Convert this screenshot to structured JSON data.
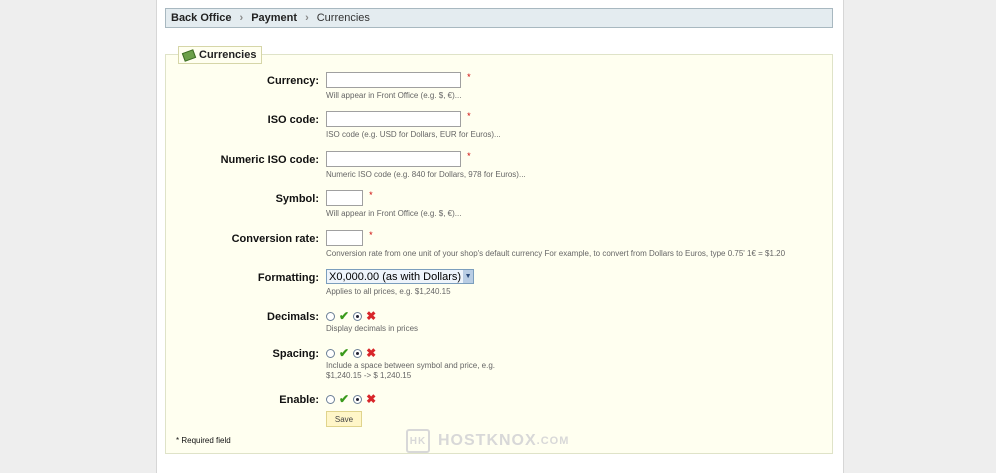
{
  "breadcrumb": {
    "items": [
      "Back Office",
      "Payment",
      "Currencies"
    ],
    "separator": "›"
  },
  "panel": {
    "legend": "Currencies",
    "legend_icon": "money-icon"
  },
  "form": {
    "currency": {
      "label": "Currency:",
      "value": "",
      "required_mark": "*",
      "hint": "Will appear in Front Office (e.g. $, €)..."
    },
    "iso_code": {
      "label": "ISO code:",
      "value": "",
      "required_mark": "*",
      "hint": "ISO code (e.g. USD for Dollars, EUR for Euros)..."
    },
    "numeric_iso_code": {
      "label": "Numeric ISO code:",
      "value": "",
      "required_mark": "*",
      "hint": "Numeric ISO code (e.g. 840 for Dollars, 978 for Euros)..."
    },
    "symbol": {
      "label": "Symbol:",
      "value": "",
      "required_mark": "*",
      "hint": "Will appear in Front Office (e.g. $, €)..."
    },
    "conversion_rate": {
      "label": "Conversion rate:",
      "value": "",
      "required_mark": "*",
      "hint": "Conversion rate from one unit of your shop's default currency  For example, to convert from Dollars to Euros, type 0.75' 1€ = $1.20"
    },
    "formatting": {
      "label": "Formatting:",
      "selected": "X0,000.00 (as with Dollars)",
      "hint": "Applies to all prices, e.g. $1,240.15"
    },
    "decimals": {
      "label": "Decimals:",
      "selected": "yes",
      "hint": "Display decimals in prices"
    },
    "spacing": {
      "label": "Spacing:",
      "selected": "yes",
      "hint_line1": "Include a space between symbol and price, e.g.",
      "hint_line2": "$1,240.15 -> $ 1,240.15"
    },
    "enable": {
      "label": "Enable:",
      "selected": "yes"
    }
  },
  "save_label": "Save",
  "required_note": "* Required field",
  "watermark": {
    "text": "HOSTKNOX",
    "suffix": ".COM",
    "logo": "HK"
  }
}
